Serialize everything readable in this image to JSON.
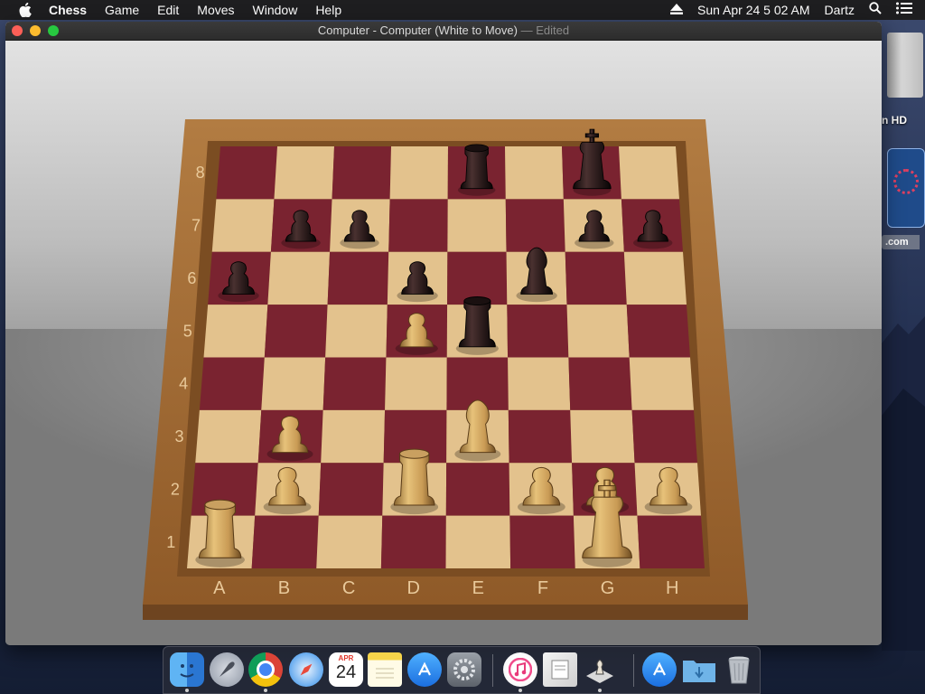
{
  "menubar": {
    "app_name": "Chess",
    "items": [
      "Game",
      "Edit",
      "Moves",
      "Window",
      "Help"
    ],
    "datetime": "Sun Apr 24  5 02 AM",
    "user": "Dartz"
  },
  "desktop": {
    "disk_label": "n HD",
    "url_label": ".com"
  },
  "window": {
    "title": "Computer - Computer   (White to Move)",
    "edited": "— Edited"
  },
  "board": {
    "files": [
      "A",
      "B",
      "C",
      "D",
      "E",
      "F",
      "G",
      "H"
    ],
    "ranks": [
      "1",
      "2",
      "3",
      "4",
      "5",
      "6",
      "7",
      "8"
    ],
    "light_color": "#e3c28d",
    "dark_color": "#7a2330",
    "frame_color": "#a06a34",
    "pieces": [
      {
        "color": "black",
        "type": "rook",
        "square": "e8"
      },
      {
        "color": "black",
        "type": "king",
        "square": "g8"
      },
      {
        "color": "black",
        "type": "pawn",
        "square": "b7"
      },
      {
        "color": "black",
        "type": "pawn",
        "square": "c7"
      },
      {
        "color": "black",
        "type": "pawn",
        "square": "g7"
      },
      {
        "color": "black",
        "type": "pawn",
        "square": "h7"
      },
      {
        "color": "black",
        "type": "pawn",
        "square": "a6"
      },
      {
        "color": "black",
        "type": "pawn",
        "square": "d6"
      },
      {
        "color": "black",
        "type": "bishop",
        "square": "f6"
      },
      {
        "color": "black",
        "type": "rook",
        "square": "e5"
      },
      {
        "color": "white",
        "type": "pawn",
        "square": "d5"
      },
      {
        "color": "white",
        "type": "pawn",
        "square": "b3"
      },
      {
        "color": "white",
        "type": "bishop",
        "square": "e3"
      },
      {
        "color": "white",
        "type": "pawn",
        "square": "b2"
      },
      {
        "color": "white",
        "type": "rook",
        "square": "d2"
      },
      {
        "color": "white",
        "type": "pawn",
        "square": "f2"
      },
      {
        "color": "white",
        "type": "pawn",
        "square": "g2"
      },
      {
        "color": "white",
        "type": "pawn",
        "square": "h2"
      },
      {
        "color": "white",
        "type": "rook",
        "square": "a1"
      },
      {
        "color": "white",
        "type": "king",
        "square": "g1"
      }
    ]
  },
  "dock": {
    "calendar_month": "APR",
    "calendar_day": "24",
    "apps": [
      {
        "name": "finder-icon",
        "running": true
      },
      {
        "name": "launchpad-icon",
        "running": false
      },
      {
        "name": "chrome-icon",
        "running": true
      },
      {
        "name": "safari-icon",
        "running": false
      },
      {
        "name": "calendar-icon",
        "running": false
      },
      {
        "name": "notes-icon",
        "running": false
      },
      {
        "name": "app-store-icon",
        "running": false
      },
      {
        "name": "system-preferences-icon",
        "running": false
      },
      {
        "name": "itunes-icon",
        "running": true
      },
      {
        "name": "preview-icon",
        "running": false
      },
      {
        "name": "chess-icon",
        "running": true
      },
      {
        "name": "app-store-icon-2",
        "running": false
      },
      {
        "name": "downloads-folder-icon",
        "running": false
      },
      {
        "name": "trash-icon",
        "running": false
      }
    ]
  }
}
